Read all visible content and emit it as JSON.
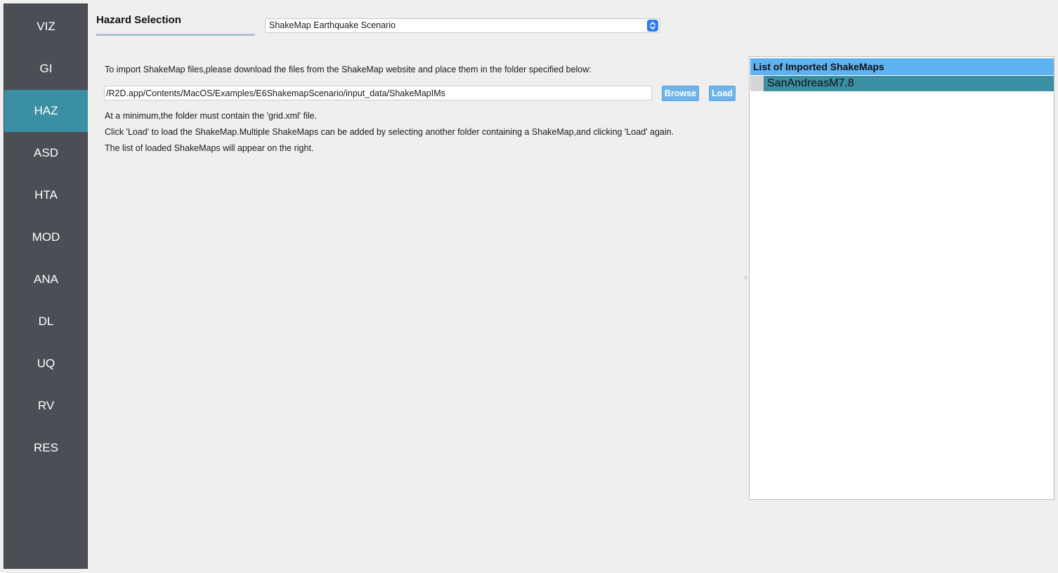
{
  "sidebar": {
    "items": [
      {
        "label": "VIZ",
        "active": false
      },
      {
        "label": "GI",
        "active": false
      },
      {
        "label": "HAZ",
        "active": true
      },
      {
        "label": "ASD",
        "active": false
      },
      {
        "label": "HTA",
        "active": false
      },
      {
        "label": "MOD",
        "active": false
      },
      {
        "label": "ANA",
        "active": false
      },
      {
        "label": "DL",
        "active": false
      },
      {
        "label": "UQ",
        "active": false
      },
      {
        "label": "RV",
        "active": false
      },
      {
        "label": "RES",
        "active": false
      }
    ]
  },
  "header": {
    "hazard_label": "Hazard Selection",
    "hazard_select_value": "ShakeMap Earthquake Scenario"
  },
  "main": {
    "intro_text": "To import ShakeMap files,please download the files from the ShakeMap website and place them in the folder specified below:",
    "path_value": "/R2D.app/Contents/MacOS/Examples/E6ShakemapScenario/input_data/ShakeMapIMs",
    "browse_label": "Browse",
    "load_label": "Load",
    "notes": [
      "At a minimum,the folder must contain the 'grid.xml' file.",
      "Click 'Load' to load the ShakeMap.Multiple ShakeMaps can be added by selecting another folder containing a ShakeMap,and clicking 'Load' again.",
      "The list of loaded ShakeMaps will appear on the right."
    ]
  },
  "shakemap_list": {
    "header": "List of Imported ShakeMaps",
    "items": [
      "SanAndreasM7.8"
    ]
  },
  "colors": {
    "sidebar_bg": "#4b4e55",
    "accent_teal": "#3a8fa3",
    "button_blue": "#6fb3ea",
    "list_header_blue": "#5eb2f0",
    "select_arrow_blue": "#2d7cf6"
  }
}
